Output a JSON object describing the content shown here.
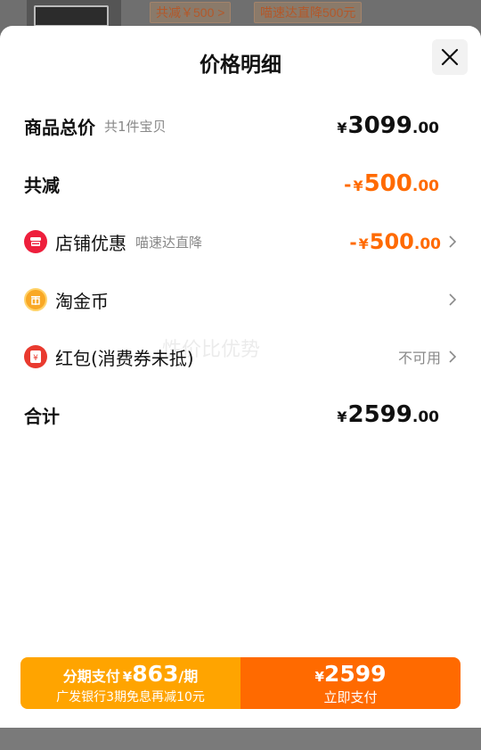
{
  "background": {
    "tags": [
      "共减￥500 >",
      "喵速达直降500元"
    ]
  },
  "sheet": {
    "title": "价格明细",
    "close_icon": "close-icon"
  },
  "rows": {
    "total": {
      "label": "商品总价",
      "sub": "共1件宝贝",
      "yen": "¥",
      "int": "3099",
      "dec": ".00"
    },
    "discount": {
      "label": "共减",
      "minus": "-",
      "yen": "¥",
      "int": "500",
      "dec": ".00"
    },
    "shop": {
      "icon": "shop-icon",
      "label": "店铺优惠",
      "sub": "喵速达直降",
      "minus": "-",
      "yen": "¥",
      "int": "500",
      "dec": ".00"
    },
    "coin": {
      "icon": "gold-coin-icon",
      "label": "淘金币"
    },
    "redpacket": {
      "icon": "red-packet-icon",
      "label": "红包(消费券未抵)",
      "status": "不可用"
    },
    "sum": {
      "label": "合计",
      "yen": "¥",
      "int": "2599",
      "dec": ".00"
    }
  },
  "watermark": "性价比优势",
  "pay_bar": {
    "installment": {
      "label": "分期支付",
      "yen": "¥",
      "amount": "863",
      "per": "/期",
      "note": "广发银行3期免息再减10元"
    },
    "pay_now": {
      "yen": "¥",
      "amount": "2599",
      "label": "立即支付"
    }
  },
  "colors": {
    "accent_orange": "#ff6a00",
    "installment_orange": "#ffa400"
  }
}
